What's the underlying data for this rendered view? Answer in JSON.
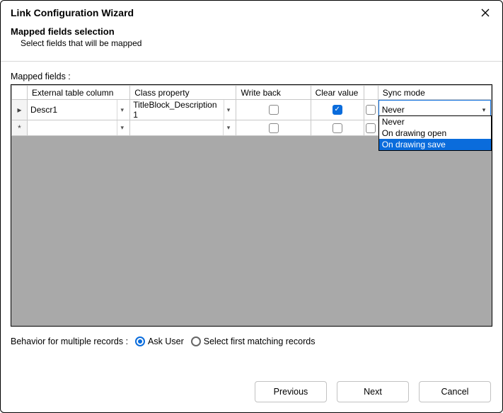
{
  "window": {
    "title": "Link Configuration Wizard"
  },
  "header": {
    "title": "Mapped fields selection",
    "subtitle": "Select fields that will be mapped"
  },
  "grid": {
    "label": "Mapped fields :",
    "columns": {
      "external": "External table column",
      "classprop": "Class property",
      "writeback": "Write back",
      "clearvalue": "Clear value",
      "syncmode": "Sync mode"
    },
    "rows": [
      {
        "marker": "▸",
        "external": "Descr1",
        "classprop": "TitleBlock_Description 1",
        "writeback_checked": false,
        "clearvalue_checked": true,
        "syncmode_value": "Never"
      },
      {
        "marker": "*",
        "external": "",
        "classprop": "",
        "writeback_checked": false,
        "clearvalue_checked": false,
        "syncmode_value": ""
      }
    ]
  },
  "syncmode_dropdown": {
    "options": [
      "Never",
      "On drawing open",
      "On drawing save"
    ],
    "highlighted": "On drawing save"
  },
  "behavior": {
    "label": "Behavior for multiple records :",
    "options": {
      "ask": "Ask User",
      "first": "Select first matching records"
    },
    "selected": "ask"
  },
  "buttons": {
    "previous": "Previous",
    "next": "Next",
    "cancel": "Cancel"
  }
}
